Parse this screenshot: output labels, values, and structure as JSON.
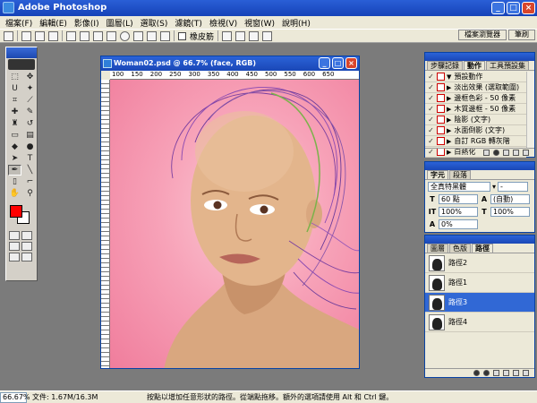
{
  "app": {
    "title": "Adobe Photoshop",
    "window_buttons": [
      "_",
      "□",
      "×"
    ]
  },
  "menu": [
    "檔案(F)",
    "編輯(E)",
    "影像(I)",
    "圖層(L)",
    "選取(S)",
    "濾鏡(T)",
    "檢視(V)",
    "視窗(W)",
    "說明(H)"
  ],
  "options_bar": {
    "rubber_band_label": "橡皮筋"
  },
  "palette_well": {
    "tabs": [
      "檔案瀏覽器",
      "筆刷"
    ]
  },
  "toolbox": {
    "active_tool": "pen-tool",
    "foreground_color": "#ff0000",
    "background_color": "#ffffff"
  },
  "document": {
    "title": "Woman02.psd @ 66.7% (face, RGB)",
    "ruler_ticks": [
      "100",
      "150",
      "200",
      "250",
      "300",
      "350",
      "400",
      "450",
      "500",
      "550",
      "600",
      "650"
    ]
  },
  "actions_panel": {
    "tabs": [
      "步驟記錄",
      "動作",
      "工具預設集"
    ],
    "active_tab": 1,
    "items": [
      {
        "label": "預設動作",
        "type": "folder"
      },
      {
        "label": "淡出效果 (選取範圍)",
        "type": "action"
      },
      {
        "label": "邊框色彩 - 50 像素",
        "type": "action"
      },
      {
        "label": "木質邊框 - 50 像素",
        "type": "action"
      },
      {
        "label": "陰影 (文字)",
        "type": "action"
      },
      {
        "label": "水面倒影 (文字)",
        "type": "action"
      },
      {
        "label": "自訂 RGB 轉灰階",
        "type": "action"
      },
      {
        "label": "白熱化",
        "type": "action"
      }
    ]
  },
  "character_panel": {
    "tabs": [
      "字元",
      "段落"
    ],
    "font_family": "全真特黑體",
    "font_style": "-",
    "font_size": "60 點",
    "leading": "(自動)",
    "vertical_scale": "100%",
    "horizontal_scale": "100%",
    "tracking": "0%"
  },
  "paths_panel": {
    "tabs": [
      "圖層",
      "色版",
      "路徑"
    ],
    "active_tab": 2,
    "items": [
      "路徑2",
      "路徑1",
      "路徑3",
      "路徑4"
    ],
    "selected_index": 2
  },
  "status": {
    "zoom": "66.67%",
    "doc_info": "文件: 1.67M/16.3M",
    "tip": "按點以增加任意形狀的路徑。從端點拖移。額外的選項請使用 Alt 和 Ctrl 鍵。"
  },
  "colors": {
    "accent": "#1a47b6",
    "selection": "#3168d5",
    "canvas_pink": "#f07d9c",
    "skin": "#e3b58c"
  }
}
